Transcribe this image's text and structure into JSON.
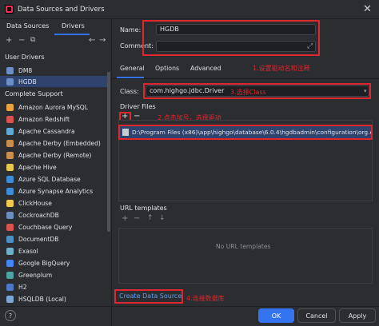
{
  "window": {
    "title": "Data Sources and Drivers"
  },
  "left": {
    "tabs": [
      "Data Sources",
      "Drivers"
    ],
    "active_tab": "Drivers",
    "user_drivers_header": "User Drivers",
    "user_drivers": [
      "DM8",
      "HGDB"
    ],
    "complete_support_header": "Complete Support",
    "complete_support": [
      "Amazon Aurora MySQL",
      "Amazon Redshift",
      "Apache Cassandra",
      "Apache Derby (Embedded)",
      "Apache Derby (Remote)",
      "Apache Hive",
      "Azure SQL Database",
      "Azure Synapse Analytics",
      "ClickHouse",
      "CockroachDB",
      "Couchbase Query",
      "DocumentDB",
      "Exasol",
      "Google BigQuery",
      "Greenplum",
      "H2",
      "HSQLDB (Local)"
    ]
  },
  "form": {
    "name_label": "Name:",
    "name_value": "HGDB",
    "comment_label": "Comment:",
    "comment_value": "",
    "note1": "1.设置驱动名和注释",
    "subtabs": [
      "General",
      "Options",
      "Advanced"
    ],
    "class_label": "Class:",
    "class_value": "com.highgo.jdbc.Driver",
    "note3": "3.选择Class",
    "driver_files_label": "Driver Files",
    "note2": "2.点击加号，选择驱动",
    "driver_file": "D:\\Program Files (x86)\\app\\highgo\\database\\6.0.4\\hgdbadmin\\configuration\\org.e",
    "url_templates_label": "URL templates",
    "no_url_templates": "No URL templates",
    "create_link": "Create Data Source",
    "note4": "4.连接数据库"
  },
  "buttons": {
    "ok": "OK",
    "cancel": "Cancel",
    "apply": "Apply",
    "help": "?"
  }
}
